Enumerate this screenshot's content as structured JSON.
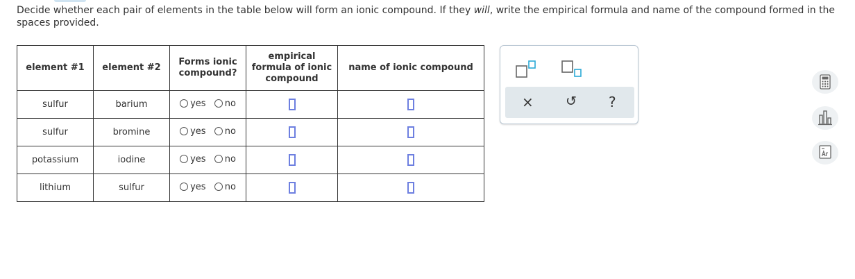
{
  "prompt": {
    "before": "Decide whether each pair of elements in the table below will form an ionic compound. If they ",
    "emph": "will",
    "after": ", write the empirical formula and name of the compound formed in the spaces provided."
  },
  "table": {
    "headers": {
      "el1": "element #1",
      "el2": "element #2",
      "forms": "Forms ionic compound?",
      "formula": "empirical formula of ionic compound",
      "name": "name of ionic compound"
    },
    "rows": [
      {
        "el1": "sulfur",
        "el2": "barium",
        "yes": "yes",
        "no": "no"
      },
      {
        "el1": "sulfur",
        "el2": "bromine",
        "yes": "yes",
        "no": "no"
      },
      {
        "el1": "potassium",
        "el2": "iodine",
        "yes": "yes",
        "no": "no"
      },
      {
        "el1": "lithium",
        "el2": "sulfur",
        "yes": "yes",
        "no": "no"
      }
    ]
  },
  "palette": {
    "icons": [
      "superscript-box-icon",
      "subscript-box-icon"
    ],
    "actions": {
      "clear": "×",
      "undo": "↺",
      "help": "?"
    }
  },
  "side_tools": [
    "calculator-icon",
    "data-chart-icon",
    "periodic-table-icon"
  ],
  "colors": {
    "accent": "#6d7fe0",
    "palette_bar": "#e1e8ec",
    "border": "#333333"
  }
}
